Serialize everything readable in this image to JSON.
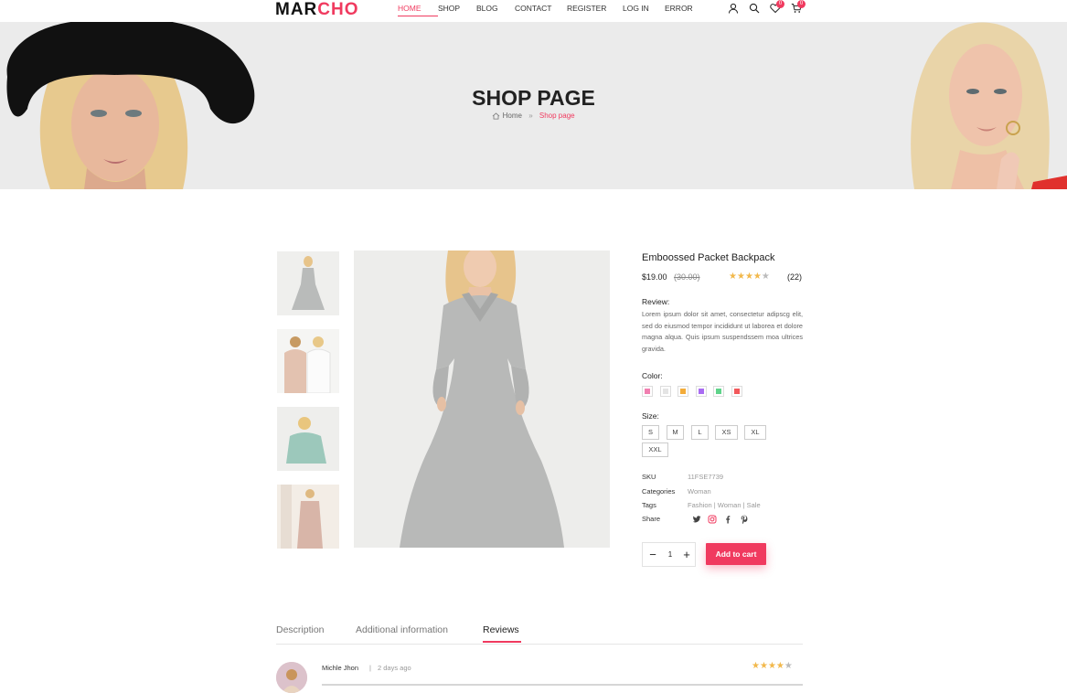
{
  "brand": {
    "logo_main": "MAR",
    "logo_accent": "CHO",
    "accent_color": "#f03a5f"
  },
  "nav": [
    {
      "label": "HOME",
      "active": true
    },
    {
      "label": "SHOP"
    },
    {
      "label": "BLOG"
    },
    {
      "label": "CONTACT"
    },
    {
      "label": "REGISTER"
    },
    {
      "label": "LOG IN"
    },
    {
      "label": "ERROR"
    }
  ],
  "header_icons": {
    "user": "user-icon",
    "search": "search-icon",
    "wishlist": "heart-icon",
    "wishlist_count": "0",
    "cart": "cart-icon",
    "cart_count": "0"
  },
  "hero": {
    "title": "SHOP PAGE",
    "breadcrumb_home": "Home",
    "breadcrumb_sep": "»",
    "breadcrumb_current": "Shop page"
  },
  "product": {
    "name": "Emboossed Packet Backpack",
    "price": "$19.00",
    "old_price": "(30.00)",
    "rating": 4,
    "rating_max": 5,
    "rating_count": "(22)",
    "review_label": "Review:",
    "description": "Lorem ipsum dolor sit amet, consectetur adipscg elit, sed do eiusmod tempor incididunt ut laborea et dolore magna alqua. Quis ipsum suspendssem moa ultrices gravida.",
    "color_label": "Color:",
    "colors": [
      "#f17fb0",
      "#e4e4e4",
      "#f3ac3a",
      "#a96cf2",
      "#5fd38a",
      "#f2585b"
    ],
    "size_label": "Size:",
    "sizes": [
      "S",
      "M",
      "L",
      "XS",
      "XL",
      "XXL"
    ],
    "meta": {
      "sku_label": "SKU",
      "sku": "11FSE7739",
      "categories_label": "Categories",
      "categories": "Woman",
      "tags_label": "Tags",
      "tags": "Fashion | Woman | Sale",
      "share_label": "Share"
    },
    "share_icons": [
      "twitter-icon",
      "instagram-icon",
      "facebook-icon",
      "pinterest-icon"
    ],
    "quantity": "1",
    "add_to_cart": "Add to cart"
  },
  "tabs": [
    {
      "label": "Description"
    },
    {
      "label": "Additional information"
    },
    {
      "label": "Reviews",
      "active": true
    }
  ],
  "review": {
    "author": "Michle Jhon",
    "separator": "|",
    "date": "2 days ago",
    "rating": 4
  }
}
